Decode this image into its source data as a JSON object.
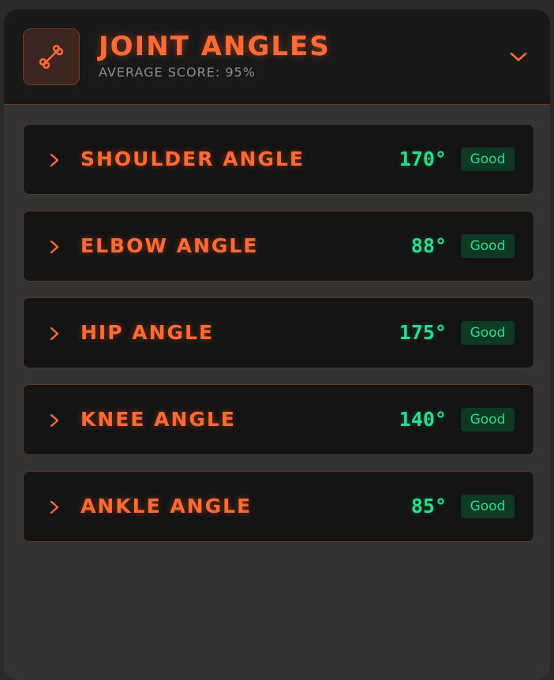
{
  "header": {
    "title": "JOINT ANGLES",
    "subtitle": "AVERAGE SCORE: 95%",
    "icon": "bone-icon",
    "toggle_icon": "chevron-down-icon"
  },
  "joints": [
    {
      "label": "SHOULDER ANGLE",
      "value": "170°",
      "status": "Good"
    },
    {
      "label": "ELBOW ANGLE",
      "value": "88°",
      "status": "Good"
    },
    {
      "label": "HIP ANGLE",
      "value": "175°",
      "status": "Good"
    },
    {
      "label": "KNEE ANGLE",
      "value": "140°",
      "status": "Good"
    },
    {
      "label": "ANKLE ANGLE",
      "value": "85°",
      "status": "Good"
    }
  ],
  "colors": {
    "accent": "#ff6a35",
    "good": "#2bdc8b",
    "good_bg": "#0e3a24",
    "panel": "#333333",
    "header_bg": "#191919"
  }
}
